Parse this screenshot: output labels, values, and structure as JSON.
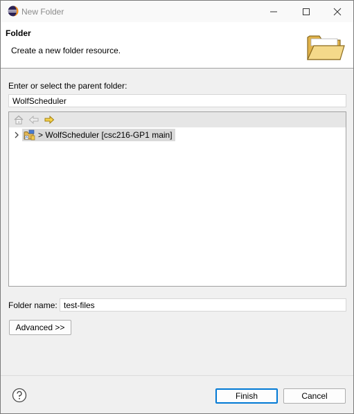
{
  "window": {
    "title": "New Folder"
  },
  "icons": {
    "app": "eclipse-icon",
    "minimize": "minimize-icon",
    "maximize": "maximize-icon",
    "close": "close-icon",
    "banner": "open-folder-icon",
    "home": "home-icon",
    "back": "back-arrow-icon",
    "forward": "forward-arrow-icon",
    "expander": "chevron-right-icon",
    "project": "project-folder-icon",
    "help": "help-icon"
  },
  "banner": {
    "title": "Folder",
    "description": "Create a new folder resource."
  },
  "parent": {
    "label": "Enter or select the parent folder:",
    "value": "WolfScheduler"
  },
  "tree": {
    "items": [
      {
        "label": "> WolfScheduler [csc216-GP1 main]",
        "expanded": false,
        "selected": true
      }
    ]
  },
  "folder": {
    "label": "Folder name:",
    "value": "test-files"
  },
  "advanced_label": "Advanced >>",
  "buttons": {
    "finish": "Finish",
    "cancel": "Cancel"
  },
  "colors": {
    "default_button_border": "#0078d4",
    "selection": "#d9d9d9",
    "toolbar": "#e6e6e6"
  }
}
